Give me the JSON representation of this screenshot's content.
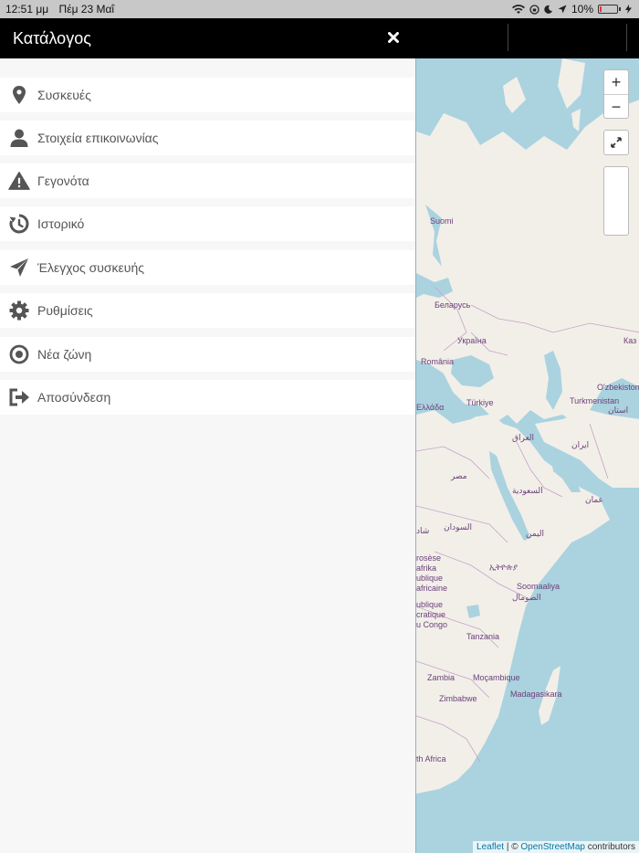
{
  "status_bar": {
    "time": "12:51 μμ",
    "date": "Πέμ 23 Μαΐ",
    "battery": "10%",
    "battery_level": 0.1
  },
  "header": {
    "title": "Κατάλογος"
  },
  "menu": {
    "items": [
      {
        "label": "Συσκευές",
        "icon": "map-pin-icon"
      },
      {
        "label": "Στοιχεία επικοινωνίας",
        "icon": "user-icon"
      },
      {
        "label": "Γεγονότα",
        "icon": "warning-icon"
      },
      {
        "label": "Ιστορικό",
        "icon": "history-icon"
      },
      {
        "label": "Έλεγχος συσκευής",
        "icon": "send-icon"
      },
      {
        "label": "Ρυθμίσεις",
        "icon": "gear-icon"
      },
      {
        "label": "Νέα ζώνη",
        "icon": "target-icon"
      },
      {
        "label": "Αποσύνδεση",
        "icon": "logout-icon"
      }
    ]
  },
  "map": {
    "zoom_in": "+",
    "zoom_out": "−",
    "labels": [
      "Suomi",
      "Беларусь",
      "Україна",
      "România",
      "Ελλάδα",
      "Türkiye",
      "Turkmenistan",
      "O'zbekiston",
      "Каз",
      "العراق",
      "ایران",
      "استان",
      "مصر",
      "السعودية",
      "عمان",
      "السودان",
      "اليمن",
      "ኢትዮጵያ",
      "Soomaaliya",
      "الصومال",
      "Tanzania",
      "Zambia",
      "Moçambique",
      "Zimbabwe",
      "Madagasikara",
      "th Africa",
      "rosèse",
      "afrika",
      "ublique",
      "africaine",
      "ublique",
      "cratique",
      "u Congo",
      "شاد"
    ],
    "attribution": {
      "leaflet": "Leaflet",
      "sep": " | © ",
      "osm": "OpenStreetMap",
      "suffix": " contributors"
    }
  },
  "colors": {
    "header_bg": "#000000",
    "water": "#aad3df",
    "land": "#f2efe9",
    "icon": "#555555"
  }
}
